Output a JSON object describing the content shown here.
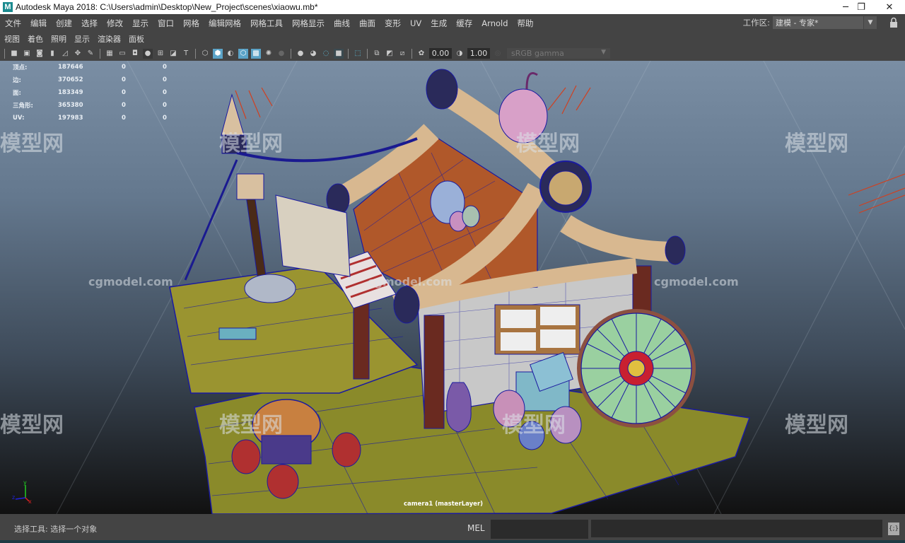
{
  "window": {
    "app_icon": "M",
    "title": "Autodesk Maya 2018: C:\\Users\\admin\\Desktop\\New_Project\\scenes\\xiaowu.mb*",
    "controls": [
      "minimize-icon",
      "restore-icon",
      "close-icon"
    ],
    "minimize": "─",
    "restore": "❐",
    "close": "✕"
  },
  "menubar": {
    "items": [
      "文件",
      "编辑",
      "创建",
      "选择",
      "修改",
      "显示",
      "窗口",
      "网格",
      "编辑网格",
      "网格工具",
      "网格显示",
      "曲线",
      "曲面",
      "变形",
      "UV",
      "生成",
      "缓存",
      "Arnold",
      "帮助"
    ]
  },
  "workspace": {
    "label": "工作区:",
    "value": "建模 - 专家*"
  },
  "panel_menu": {
    "items": [
      "视图",
      "着色",
      "照明",
      "显示",
      "渲染器",
      "面板"
    ]
  },
  "toolbar": {
    "exposure": "0.00",
    "gamma": "1.00",
    "color_space": "sRGB gamma"
  },
  "hud": {
    "rows": [
      {
        "label": "顶点:",
        "value": "187646",
        "c2": "0",
        "c3": "0"
      },
      {
        "label": "边:",
        "value": "370652",
        "c2": "0",
        "c3": "0"
      },
      {
        "label": "面:",
        "value": "183349",
        "c2": "0",
        "c3": "0"
      },
      {
        "label": "三角形:",
        "value": "365380",
        "c2": "0",
        "c3": "0"
      },
      {
        "label": "UV:",
        "value": "197983",
        "c2": "0",
        "c3": "0"
      }
    ],
    "camera": "camera1 (masterLayer)",
    "axis": {
      "x": "x",
      "y": "y",
      "z": "z"
    }
  },
  "watermarks": {
    "cn": "模型网",
    "en": "cgmodel.com"
  },
  "command_line": {
    "status": "选择工具: 选择一个对象",
    "lang": "MEL",
    "input_value": "",
    "output_value": ""
  }
}
